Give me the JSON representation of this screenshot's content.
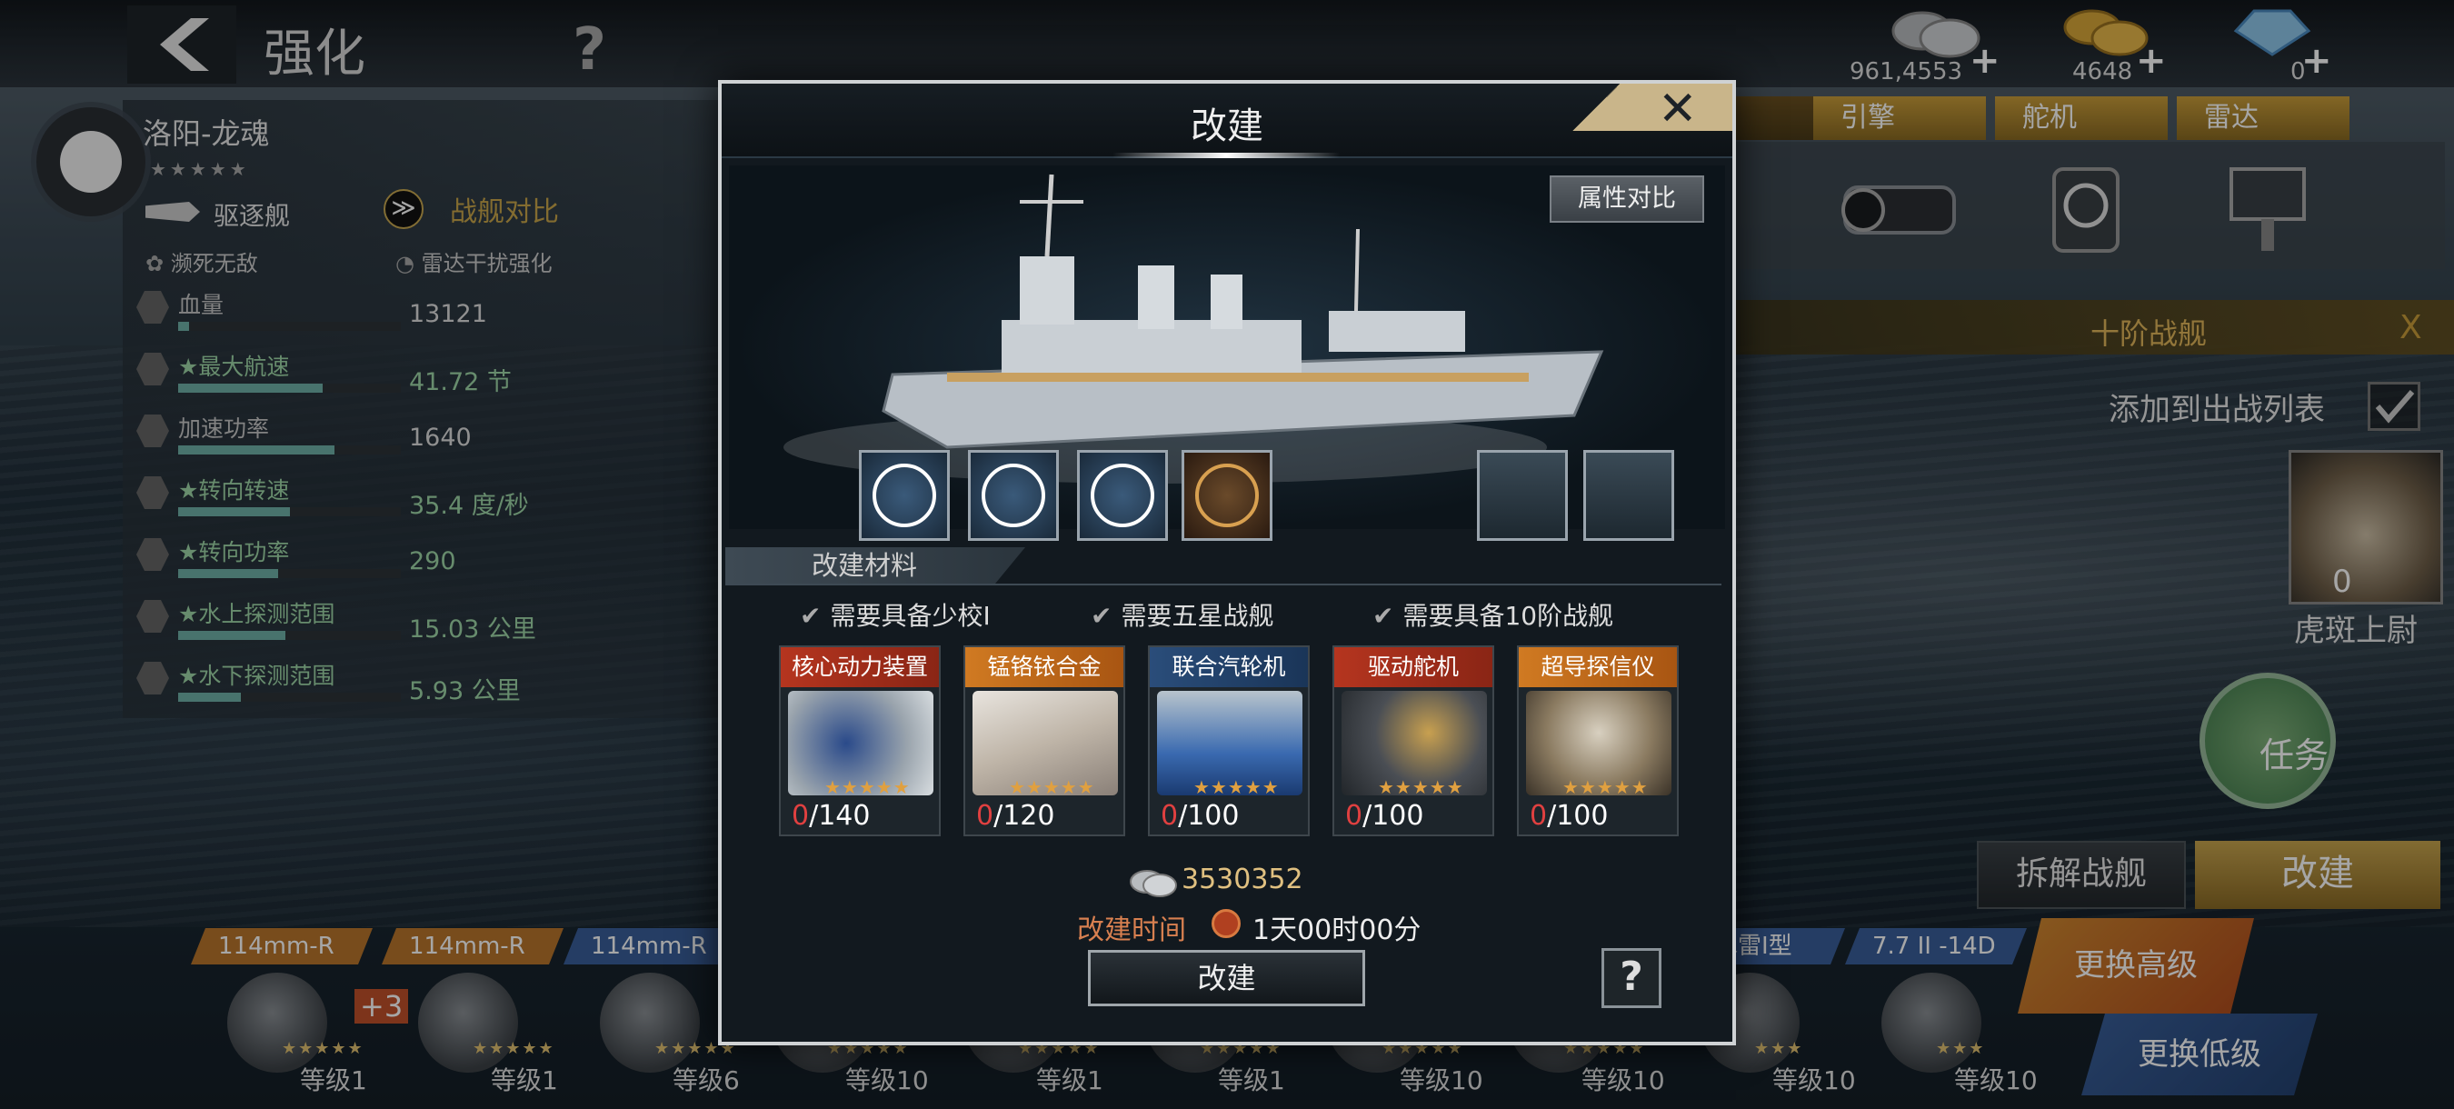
{
  "topbar": {
    "back_icon": "chevron-left-icon",
    "title": "强化",
    "help": "?",
    "currencies": [
      {
        "name": "silver",
        "icon": "silver-coins-icon",
        "value": "961,4553",
        "plus": "+"
      },
      {
        "name": "gold",
        "icon": "gold-coins-icon",
        "value": "4648",
        "plus": "+"
      },
      {
        "name": "diamond",
        "icon": "diamond-icon",
        "value": "0",
        "plus": "+"
      }
    ]
  },
  "ship": {
    "name": "洛阳-龙魂",
    "stars": "★★★★★",
    "type": "驱逐舰",
    "compare_label": "战舰对比",
    "skills": [
      "濒死无敌",
      "雷达干扰强化"
    ]
  },
  "stats": [
    {
      "label": "血量",
      "value": "13121",
      "starred": false,
      "fill": 0.05
    },
    {
      "label": "★最大航速",
      "value": "41.72 节",
      "starred": true,
      "fill": 0.65
    },
    {
      "label": "加速功率",
      "value": "1640",
      "starred": false,
      "fill": 0.7
    },
    {
      "label": "★转向转速",
      "value": "35.4 度/秒",
      "starred": true,
      "fill": 0.5
    },
    {
      "label": "★转向功率",
      "value": "290",
      "starred": true,
      "fill": 0.45
    },
    {
      "label": "★水上探测范围",
      "value": "15.03 公里",
      "starred": true,
      "fill": 0.48
    },
    {
      "label": "★水下探测范围",
      "value": "5.93 公里",
      "starred": true,
      "fill": 0.28
    }
  ],
  "right": {
    "equip_tabs": [
      "引擎",
      "舵机",
      "雷达"
    ],
    "tier": "十阶战舰",
    "tier_x": "X",
    "add_to_battle": "添加到出战列表",
    "captain_level": "0",
    "captain_name": "虎斑上尉",
    "task": "任务",
    "dismantle": "拆解战舰",
    "refit": "改建"
  },
  "bottom": {
    "weapons": [
      {
        "name": "114mm-R",
        "level": "等级1",
        "color": "#b8752c"
      },
      {
        "name": "114mm-R",
        "level": "等级1",
        "color": "#b8752c"
      },
      {
        "name": "114mm-R",
        "level": "等级6",
        "color": "#3a5f9a"
      },
      {
        "name": "",
        "level": "等级10",
        "color": "#3a5f9a"
      },
      {
        "name": "",
        "level": "等级1",
        "color": "#3a5f9a"
      },
      {
        "name": "",
        "level": "等级1",
        "color": "#3a5f9a"
      },
      {
        "name": "",
        "level": "等级10",
        "color": "#3a5f9a"
      },
      {
        "name": "",
        "level": "等级10",
        "color": "#3a5f9a"
      },
      {
        "name": "鱼水雷Ⅰ型",
        "level": "等级10",
        "color": "#3a5f9a"
      },
      {
        "name": "7.7 II -14D",
        "level": "等级10",
        "color": "#3a5f9a"
      }
    ],
    "plus_badge": "+3",
    "change_high": "更换高级",
    "change_low": "更换低级"
  },
  "modal": {
    "title": "改建",
    "close": "✕",
    "attr_compare": "属性对比",
    "materials_title": "改建材料",
    "requirements": [
      "需要具备少校Ⅰ",
      "需要五星战舰",
      "需要具备10阶战舰"
    ],
    "materials": [
      {
        "name": "核心动力装置",
        "have": "0",
        "need": "/140",
        "stars": "★★★★★",
        "tag": "red"
      },
      {
        "name": "锰铬铱合金",
        "have": "0",
        "need": "/120",
        "stars": "★★★★★",
        "tag": "orange"
      },
      {
        "name": "联合汽轮机",
        "have": "0",
        "need": "/100",
        "stars": "★★★★★",
        "tag": "blue"
      },
      {
        "name": "驱动舵机",
        "have": "0",
        "need": "/100",
        "stars": "★★★★★",
        "tag": "red"
      },
      {
        "name": "超导探信仪",
        "have": "0",
        "need": "/100",
        "stars": "★★★★★",
        "tag": "orange"
      }
    ],
    "cost": "3530352",
    "time_label": "改建时间",
    "time_value": "1天00时00分",
    "refit_button": "改建",
    "help": "?"
  }
}
